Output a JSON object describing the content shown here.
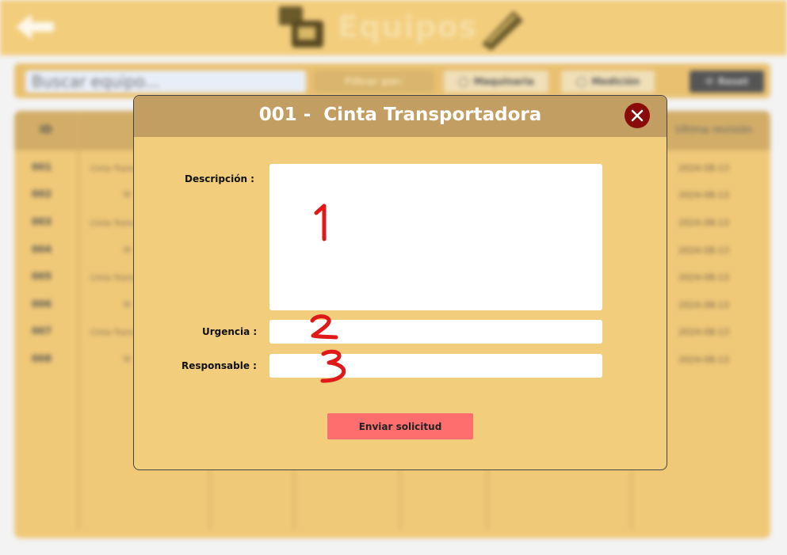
{
  "background": {
    "app_title": "Equipos",
    "search_placeholder": "Buscar equipo...",
    "toolbar": {
      "filter_label": "Filtrar por:",
      "option_a": "Maquinaria",
      "option_b": "Medición",
      "reset_label": "Reset"
    },
    "table": {
      "id_header": "ID",
      "last_header": "Ultima revisión",
      "ids": [
        "001",
        "002",
        "003",
        "004",
        "005",
        "006",
        "007",
        "008"
      ],
      "name_snippets": [
        "Cinta Trans",
        "M",
        "Cinta Trans",
        "M",
        "Cinta Trans",
        "M",
        "Cinta Trans",
        "M"
      ],
      "dates": [
        "2024-08-13",
        "2024-08-13",
        "2024-08-13",
        "2024-08-13",
        "2024-08-13",
        "2024-08-13",
        "2024-08-13",
        "2024-08-13"
      ]
    }
  },
  "modal": {
    "title": "001 -  Cinta Transportadora",
    "fields": {
      "description_label": "Descripción :",
      "urgency_label": "Urgencia :",
      "responsible_label": "Responsable :"
    },
    "annotations": [
      "1",
      "2",
      "3"
    ],
    "submit_label": "Enviar solicitud"
  },
  "colors": {
    "panel": "#f2cd7c",
    "header": "#c39e62",
    "close": "#8b0b0b",
    "submit": "#ff6e6e"
  }
}
